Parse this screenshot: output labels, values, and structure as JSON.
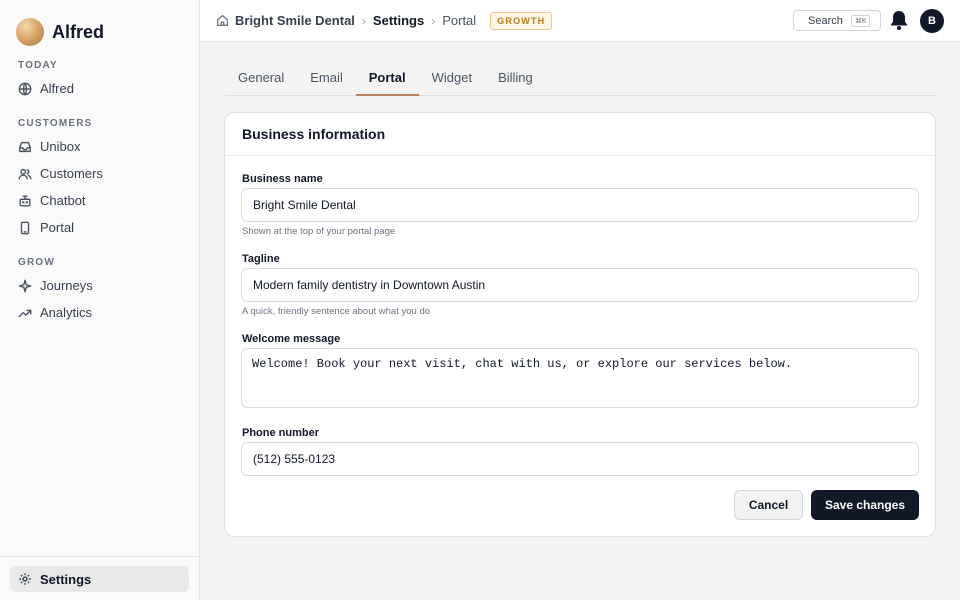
{
  "sidebar": {
    "brand": "Alfred",
    "sections": [
      {
        "title": "TODAY",
        "items": [
          {
            "label": "Alfred",
            "icon": "globe-icon"
          }
        ]
      },
      {
        "title": "CUSTOMERS",
        "items": [
          {
            "label": "Unibox",
            "icon": "inbox-icon"
          },
          {
            "label": "Customers",
            "icon": "users-icon"
          },
          {
            "label": "Chatbot",
            "icon": "bot-icon"
          },
          {
            "label": "Portal",
            "icon": "phone-icon"
          }
        ]
      },
      {
        "title": "GROW",
        "items": [
          {
            "label": "Journeys",
            "icon": "sparkle-icon"
          },
          {
            "label": "Analytics",
            "icon": "trend-icon"
          }
        ]
      }
    ],
    "settings_label": "Settings"
  },
  "topbar": {
    "breadcrumb": [
      "Bright Smile Dental",
      "Settings",
      "Portal"
    ],
    "separator": "›",
    "plan_badge": "GROWTH",
    "search_label": "Search",
    "search_shortcut": "⌘K",
    "avatar_initial": "B"
  },
  "tabs": [
    {
      "label": "General",
      "active": false
    },
    {
      "label": "Email",
      "active": false
    },
    {
      "label": "Portal",
      "active": true
    },
    {
      "label": "Widget",
      "active": false
    },
    {
      "label": "Billing",
      "active": false
    }
  ],
  "form": {
    "title": "Business information",
    "business_name": {
      "label": "Business name",
      "value": "Bright Smile Dental",
      "hint": "Shown at the top of your portal page"
    },
    "tagline": {
      "label": "Tagline",
      "value": "Modern family dentistry in Downtown Austin",
      "hint": "A quick, friendly sentence about what you do"
    },
    "welcome": {
      "label": "Welcome message",
      "value": "Welcome! Book your next visit, chat with us, or explore our services below."
    },
    "phone": {
      "label": "Phone number",
      "value": "(512) 555-0123"
    },
    "cancel_label": "Cancel",
    "save_label": "Save changes"
  },
  "colors": {
    "accent": "#b8835a",
    "primary_button": "#111827",
    "badge_text": "#b7791f"
  }
}
